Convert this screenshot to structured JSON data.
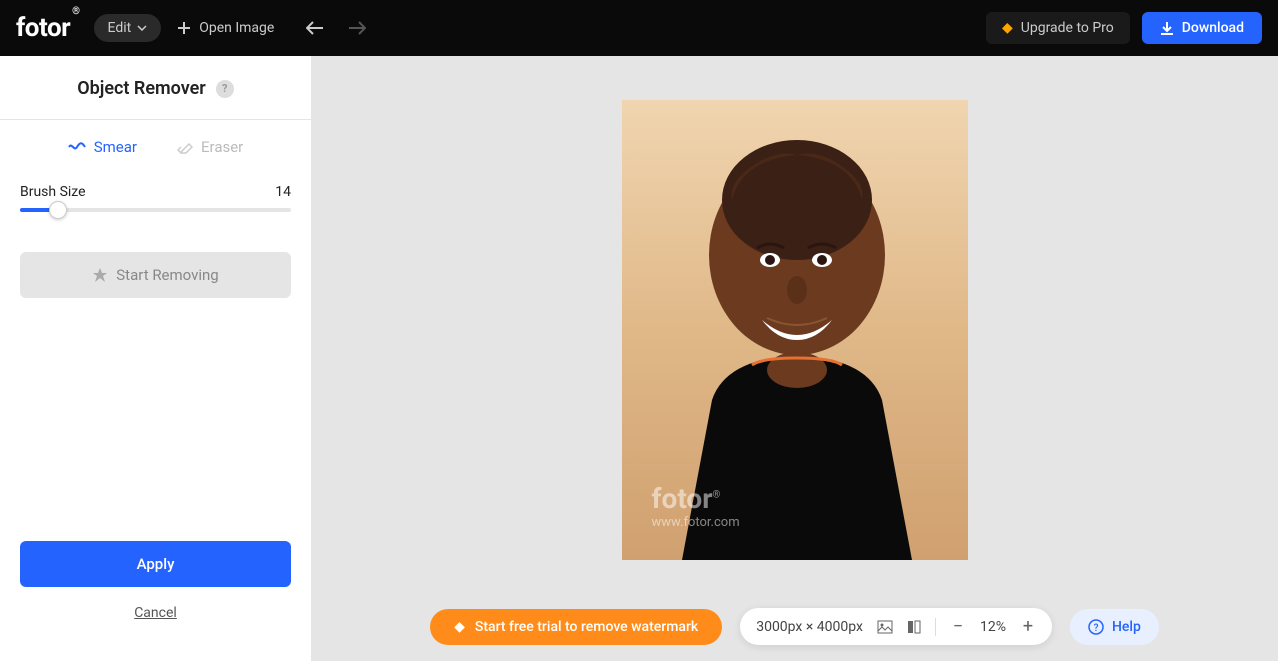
{
  "header": {
    "logo": "fotor",
    "edit_label": "Edit",
    "open_image": "Open Image",
    "upgrade": "Upgrade to Pro",
    "download": "Download"
  },
  "sidebar": {
    "title": "Object Remover",
    "tabs": {
      "smear": "Smear",
      "eraser": "Eraser"
    },
    "brush_label": "Brush Size",
    "brush_value": "14",
    "start_removing": "Start Removing",
    "apply": "Apply",
    "cancel": "Cancel"
  },
  "canvas": {
    "trial": "Start free trial to remove watermark",
    "dimensions": "3000px × 4000px",
    "zoom": "12%",
    "help": "Help",
    "watermark_logo": "fotor",
    "watermark_url": "www.fotor.com"
  }
}
